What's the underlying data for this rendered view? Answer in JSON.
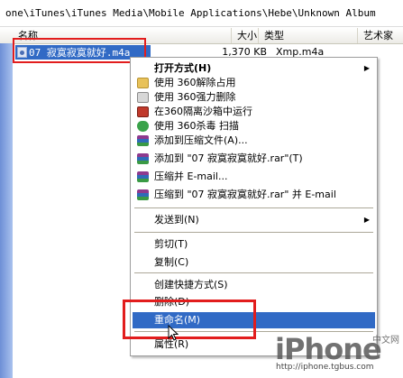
{
  "address": "one\\iTunes\\iTunes Media\\Mobile Applications\\Hebe\\Unknown Album",
  "columns": {
    "name": "名称",
    "size": "大小",
    "type": "类型",
    "artist": "艺术家"
  },
  "file": {
    "name": "07 寂寞寂寞就好.m4a",
    "size": "1,370 KB",
    "type": "Xmp.m4a"
  },
  "menu": {
    "open_with": "打开方式(H)",
    "unlock_360": "使用 360解除占用",
    "force_delete_360": "使用 360强力删除",
    "sandbox_360": "在360隔离沙箱中运行",
    "scan_360": "使用 360杀毒 扫描",
    "add_archive": "添加到压缩文件(A)...",
    "add_rar": "添加到 \"07 寂寞寂寞就好.rar\"(T)",
    "compress_email": "压缩并 E-mail...",
    "compress_rar_email": "压缩到 \"07 寂寞寂寞就好.rar\" 并 E-mail",
    "send_to": "发送到(N)",
    "cut": "剪切(T)",
    "copy": "复制(C)",
    "create_shortcut": "创建快捷方式(S)",
    "delete": "删除(D)",
    "rename": "重命名(M)",
    "properties": "属性(R)"
  },
  "watermark": {
    "logo": "iPhone",
    "cn": "中文网",
    "url": "http://iphone.tgbus.com"
  },
  "colors": {
    "selection": "#316ac5",
    "highlight_box": "#e21d1d"
  },
  "icons": {
    "unlock_360": "folder-icon",
    "force_delete_360": "shredder-icon",
    "sandbox_360": "sandbox-icon",
    "scan_360": "shield-icon",
    "winrar": "winrar-books-icon"
  }
}
